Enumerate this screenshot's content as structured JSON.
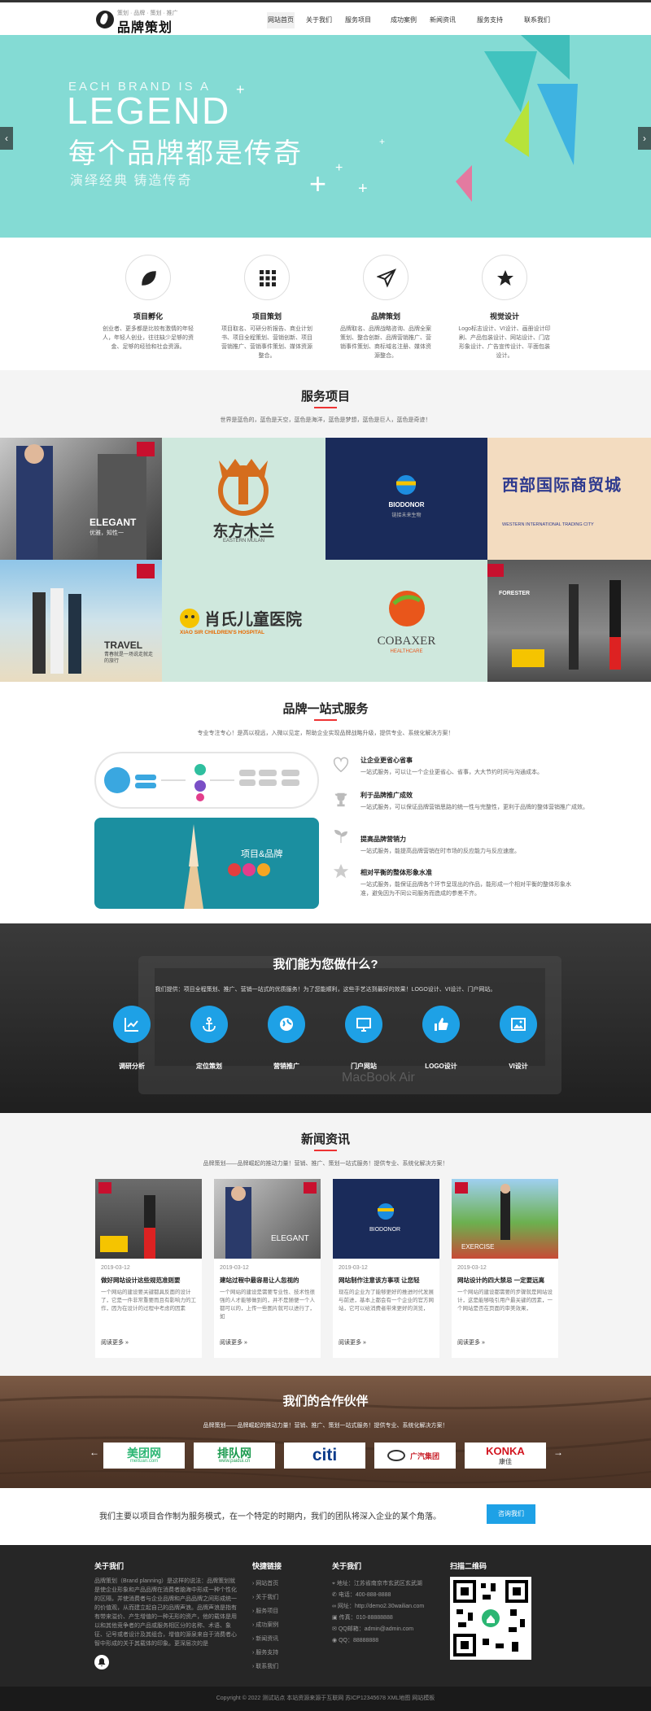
{
  "header": {
    "logo_sub": "策划 · 品牌 · 策划 · 推广",
    "logo_name": "品牌策划",
    "nav": [
      "网站首页",
      "关于我们",
      "服务项目",
      "成功案例",
      "新闻资讯",
      "服务支持",
      "联系我们"
    ],
    "active_index": 0
  },
  "banner": {
    "en_line1": "EACH BRAND IS A",
    "en_line2": "LEGEND",
    "cn_title": "每个品牌都是传奇",
    "slogan": "演绎经典  铸造传奇",
    "prev": "‹",
    "next": "›"
  },
  "features": [
    {
      "icon": "leaf-icon",
      "title": "项目孵化",
      "desc": "创业者、更多都是比较有激情的年轻人，年轻人创业，往往缺少足够的资金、足够的经验和社会资源。"
    },
    {
      "icon": "grid-icon",
      "title": "项目策划",
      "desc": "项目取名、可研分析报告、商业计划书、项目全程策划、营销创新、项目营销推广、营销事件策划、媒体资源整合。"
    },
    {
      "icon": "paper-plane-icon",
      "title": "品牌策划",
      "desc": "品牌取名、品牌战略咨询、品牌全案策划、整合创新、品牌营销推广、营销事件策划、商标域名注册、媒体资源整合。"
    },
    {
      "icon": "star-icon",
      "title": "视觉设计",
      "desc": "Logo标志设计、VI设计、画册设计印刷、产品包装设计、网站设计、门店形象设计、广告宣传设计、平面包装设计。"
    }
  ],
  "services": {
    "title": "服务项目",
    "subtitle": "世界是蓝色的，蓝色是天空，蓝色是海洋，蓝色是梦想，蓝色是巨人，蓝色是奇迹！",
    "tiles": [
      {
        "label": "ELEGANT",
        "sub": "优雅，知性一"
      },
      {
        "label": "东方木兰",
        "sub": "EASTERN MULAN"
      },
      {
        "label": "BIODONOR",
        "sub": "链接未来生物"
      },
      {
        "label": "西部国际商贸城",
        "sub": "WESTERN INTERNATIONAL TRADING CITY"
      },
      {
        "label": "TRAVEL",
        "sub": "青春就是一场说走就走的旅行"
      },
      {
        "label": "肖氏儿童医院",
        "sub": "XIAO SIR CHILDREN'S HOSPITAL"
      },
      {
        "label": "COBAXER",
        "sub": "HEALTHCARE"
      },
      {
        "label": "FORESTER",
        "sub": ""
      }
    ]
  },
  "onestop": {
    "title": "品牌一站式服务",
    "subtitle": "专业专注专心！是高以视远，入微以见定，帮助企业实现品牌战略升级，提供专业、系统化解决方案！",
    "card_label": "项目&品牌",
    "advantages": [
      {
        "icon": "heart-icon",
        "title": "让企业更省心省事",
        "desc": "一站式服务，可以让一个企业更省心、省事，大大节约时间与沟通成本。"
      },
      {
        "icon": "trophy-icon",
        "title": "利于品牌推广成效",
        "desc": "一站式服务，可以保证品牌营销思路的统一性与完整性，更利于品牌的整体营销推广成效。"
      },
      {
        "icon": "sprout-icon",
        "title": "提高品牌营销力",
        "desc": "一站式服务，能提高品牌营销在时市场的反应能力与反应速度。"
      },
      {
        "icon": "star-outline-icon",
        "title": "相对平衡的整体形象水准",
        "desc": "一站式服务，能保证品牌各个环节呈现出的作品，能形成一个相对平衡的整体形象水准，避免因为不同公司服务而造成的参差不齐。"
      }
    ]
  },
  "whatwedo": {
    "title": "我们能为您做什么?",
    "subtitle": "我们提供：项目全程策划、推广、营销一站式的优质服务！为了您能顺利，这些手艺达到最好的效果！LOGO设计、VI设计、门户网站。",
    "items": [
      {
        "icon": "chart-icon",
        "label": "调研分析"
      },
      {
        "icon": "anchor-icon",
        "label": "定位策划"
      },
      {
        "icon": "globe-icon",
        "label": "营销推广"
      },
      {
        "icon": "monitor-icon",
        "label": "门户网站"
      },
      {
        "icon": "thumbs-up-icon",
        "label": "LOGO设计"
      },
      {
        "icon": "image-icon",
        "label": "VI设计"
      }
    ]
  },
  "news": {
    "title": "新闻资讯",
    "subtitle": "品牌策划——品牌崛起的推动力量！营销、推广、策划一站式服务！提供专业、系统化解决方案！",
    "more": "阅读更多 »",
    "items": [
      {
        "date": "2019-03-12",
        "title": "做好网站设计这些规范准则要",
        "desc": "一个网站的建设要关键都具反面的设计了，它是一件非常重要而且有影响力的工作，因为在设计的过程中考虑的因素"
      },
      {
        "date": "2019-03-12",
        "title": "建站过程中最容易让人忽视的",
        "desc": "一个网站的建设是需要专业性、技术性很强的人才能够做到的，并不是随便一个人都可以的，上传一些图片就可以进行了，如"
      },
      {
        "date": "2019-03-12",
        "title": "网站制作注意该方事项 让您轻",
        "desc": "现在的企业为了能够更好的推进时代发展与前进，基本上都会有一个企业的官方网站，它可以给消费者带来更好的浏览，"
      },
      {
        "date": "2019-03-12",
        "title": "网站设计的四大禁忌 一定要远离",
        "desc": "一个网站的建设都需要的步骤就是网站设计，这是能够吸引用户最关键的因素，一个网站是否在页面的审美效果，"
      }
    ]
  },
  "partners": {
    "title": "我们的合作伙伴",
    "subtitle": "品牌策划——品牌崛起的推动力量！营销、推广、策划一站式服务！提供专业、系统化解决方案！",
    "logos": [
      {
        "name": "美团网",
        "sub": "meituan.com",
        "color": "#2bb673"
      },
      {
        "name": "排队网",
        "sub": "www.paidui.cn",
        "color": "#1b9a4e"
      },
      {
        "name": "citi",
        "sub": "",
        "color": "#0a3a8a"
      },
      {
        "name": "广汽集团",
        "sub": "",
        "color": "#c81e28"
      },
      {
        "name": "KONKA",
        "sub": "康佳",
        "color": "#d2141f"
      }
    ]
  },
  "cta": {
    "text": "我们主要以项目合作制为服务模式，在一个特定的时期内，我们的团队将深入企业的某个角落。",
    "button": "咨询我们"
  },
  "footer": {
    "about_title": "关于我们",
    "about_text": "品牌策划（Brand planning）是这样的说法：品牌策划就是使企业形象和产品品牌在消费者脑海中形成一种个性化的区隔，并使消费者与企业品牌和产品品牌之间形成统一的价值观，从而建立起自己的品牌声浪。品牌声浪是指有有带来溢价、产生增值的一种无形的资产，他的载体是用以和其他竞争者的产品或服务相区分的名称、术语、象征、记号或者设计及其组合，增值的源泉来自于消费者心智中形成的关于其载体的印象。更深层次的是",
    "links_title": "快捷链接",
    "links": [
      "网站首页",
      "关于我们",
      "服务项目",
      "成功案例",
      "新闻资讯",
      "服务支持",
      "联系我们"
    ],
    "contact_title": "关于我们",
    "contact": [
      "地址：江苏省南京市玄武区玄武湖",
      "电话：400-888-8888",
      "网址：http://demo2.30wailian.com",
      "传真：010-88888888",
      "QQ邮箱：admin@admin.com",
      "QQ：88888888"
    ],
    "qr_title": "扫描二维码"
  },
  "copyright": "Copyright © 2022 测试站点 本站资源来源于互联网  苏ICP12345678  XML地图 网站模板"
}
